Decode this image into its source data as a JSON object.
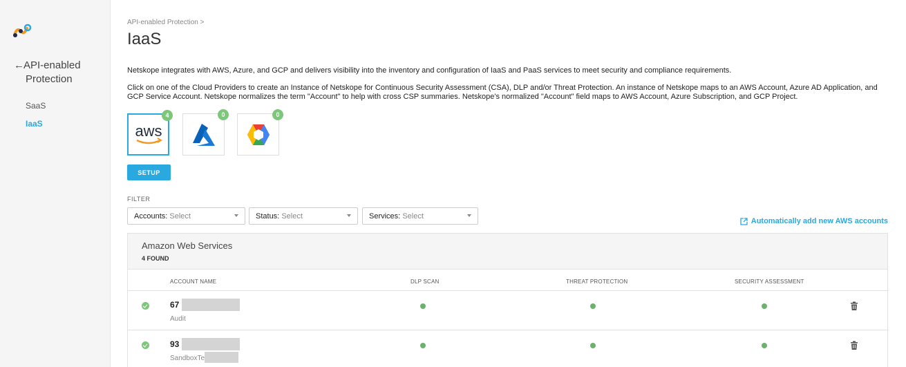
{
  "sidebar": {
    "back_line1": "API-enabled",
    "back_line2": "Protection",
    "items": [
      {
        "label": "SaaS"
      },
      {
        "label": "IaaS"
      }
    ]
  },
  "header": {
    "breadcrumb": "API-enabled Protection >",
    "title": "IaaS"
  },
  "intro": {
    "p1": "Netskope integrates with AWS, Azure, and GCP and delivers visibility into the inventory and configuration of IaaS and PaaS services to meet security and compliance requirements.",
    "p2": "Click on one of the Cloud Providers to create an Instance of Netskope for Continuous Security Assessment (CSA), DLP and/or Threat Protection. An instance of Netskope maps to an AWS Account, Azure AD Application, and GCP Service Account. Netskope normalizes the term \"Account\" to help with cross CSP summaries. Netskope's normalized \"Account\" field maps to AWS Account, Azure Subscription, and GCP Project."
  },
  "providers": [
    {
      "name": "aws",
      "logo_text": "aws",
      "count": "4",
      "selected": true
    },
    {
      "name": "azure",
      "count": "0"
    },
    {
      "name": "gcp",
      "count": "0"
    }
  ],
  "setup_label": "SETUP",
  "filter": {
    "label": "FILTER",
    "accounts_label": "Accounts:",
    "accounts_value": "Select",
    "status_label": "Status:",
    "status_value": "Select",
    "services_label": "Services:",
    "services_value": "Select"
  },
  "auto_link": "Automatically add new AWS accounts",
  "panel": {
    "title": "Amazon Web Services",
    "count": "4 FOUND",
    "columns": [
      "ACCOUNT NAME",
      "DLP SCAN",
      "THREAT PROTECTION",
      "SECURITY ASSESSMENT"
    ],
    "rows": [
      {
        "name": "67",
        "sub": "Audit"
      },
      {
        "name": "93",
        "sub": "SandboxTe"
      }
    ]
  },
  "colors": {
    "accent": "#2aa9e0",
    "status_green": "#6bb36b",
    "badge_green": "#7dc77a"
  }
}
